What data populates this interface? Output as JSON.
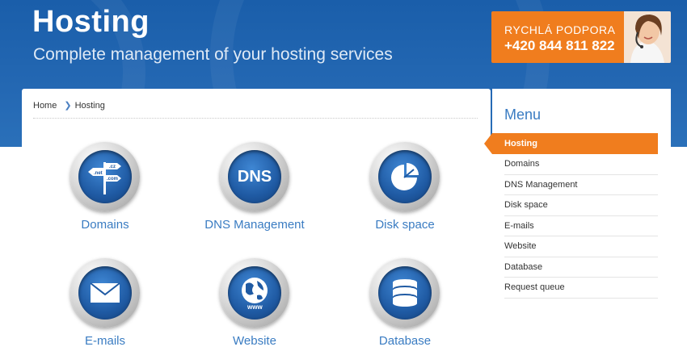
{
  "header": {
    "title": "Hosting",
    "subtitle": "Complete management of your hosting services"
  },
  "support": {
    "label": "RYCHLÁ PODPORA",
    "phone": "+420 844 811 822"
  },
  "breadcrumb": {
    "home": "Home",
    "current": "Hosting"
  },
  "services": [
    {
      "label": "Domains",
      "icon": "domains-icon",
      "icon_text": [
        ".net",
        ".cz",
        ".com"
      ]
    },
    {
      "label": "DNS Management",
      "icon": "dns-icon",
      "icon_text": "DNS"
    },
    {
      "label": "Disk space",
      "icon": "pie-chart-icon"
    },
    {
      "label": "E-mails",
      "icon": "envelope-icon"
    },
    {
      "label": "Website",
      "icon": "globe-icon",
      "icon_text": "www"
    },
    {
      "label": "Database",
      "icon": "database-icon"
    }
  ],
  "sidebar": {
    "title": "Menu",
    "items": [
      {
        "label": "Hosting",
        "active": true
      },
      {
        "label": "Domains"
      },
      {
        "label": "DNS Management"
      },
      {
        "label": "Disk space"
      },
      {
        "label": "E-mails"
      },
      {
        "label": "Website"
      },
      {
        "label": "Database"
      },
      {
        "label": "Request queue"
      }
    ]
  },
  "colors": {
    "header_blue": "#2468b3",
    "accent_orange": "#f07d1e",
    "link_blue": "#3a7cc2"
  }
}
